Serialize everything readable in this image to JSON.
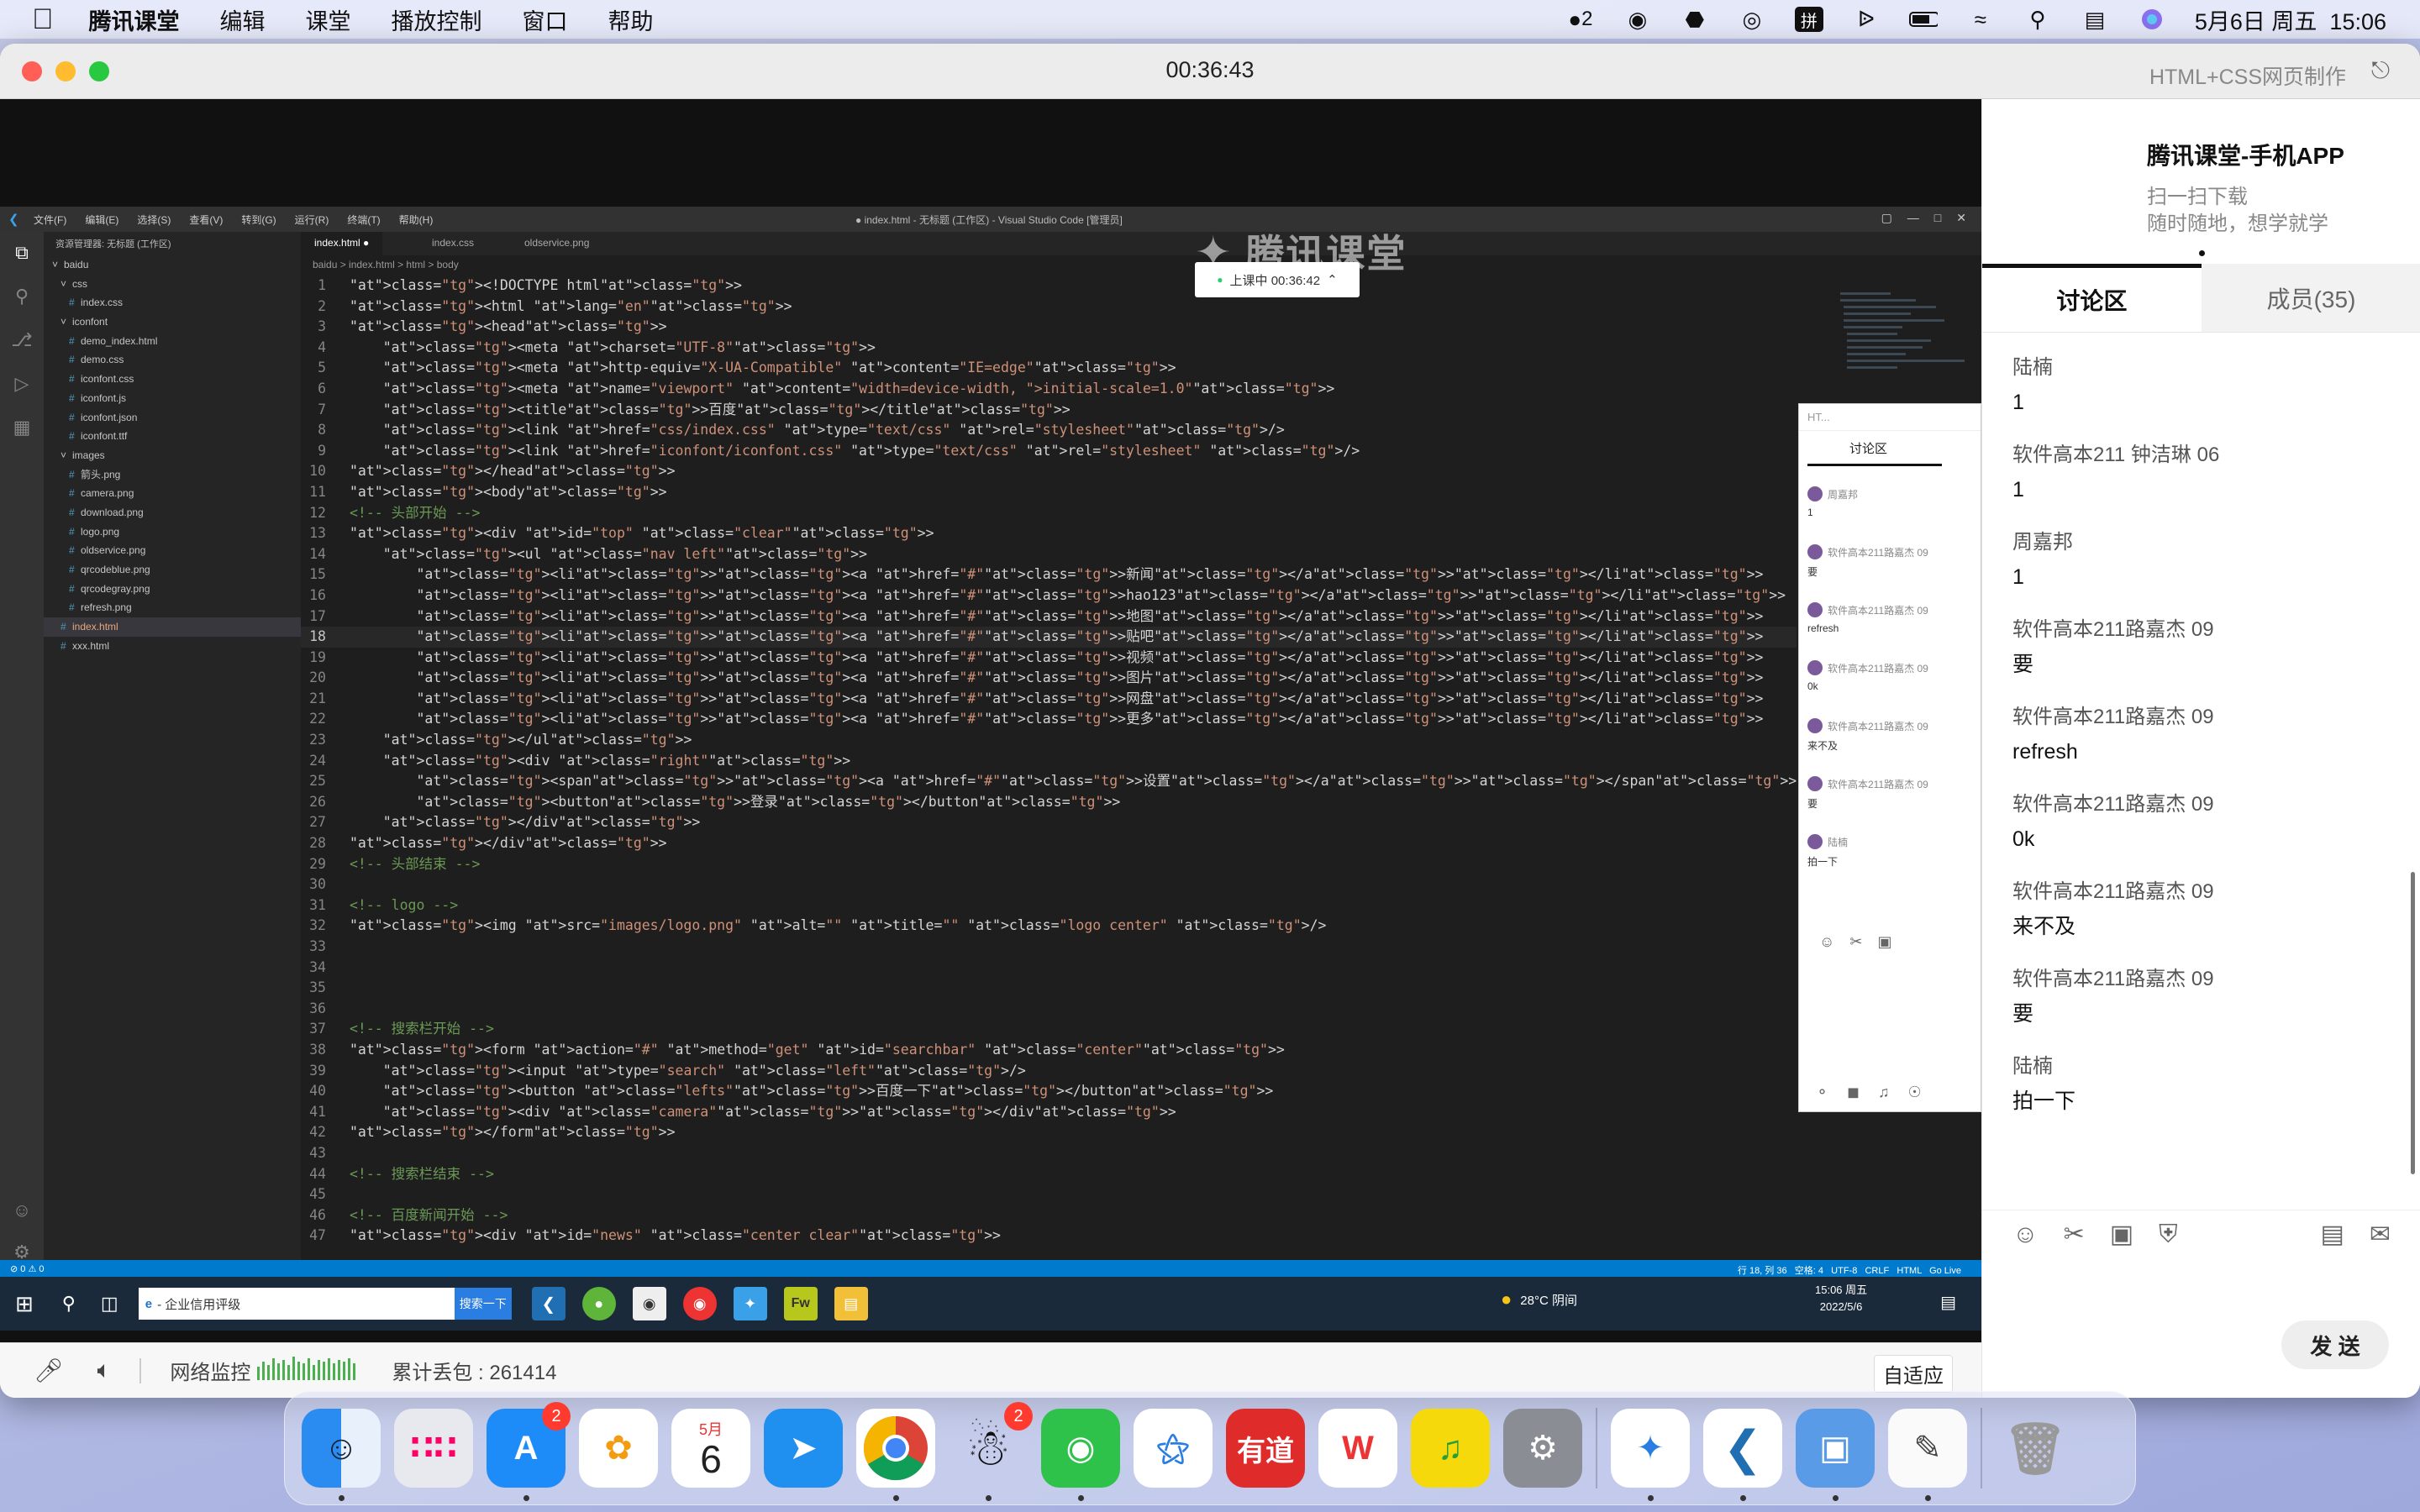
{
  "menubar": {
    "app_name": "腾讯课堂",
    "items": [
      "编辑",
      "课堂",
      "播放控制",
      "窗口",
      "帮助"
    ],
    "qq_badge": "2",
    "ime_label": "拼",
    "datetime": "5月6日 周五  15:06"
  },
  "window": {
    "timer": "00:36:43",
    "course_name": "HTML+CSS网页制作"
  },
  "video": {
    "watermark": "腾讯课堂",
    "live_badge": "上课中 00:36:42",
    "vscode": {
      "title": "● index.html - 无标题 (工作区) - Visual Studio Code [管理员]",
      "menu": [
        "文件(F)",
        "编辑(E)",
        "选择(S)",
        "查看(V)",
        "转到(G)",
        "运行(R)",
        "终端(T)",
        "帮助(H)"
      ],
      "explorer_header": "资源管理器: 无标题 (工作区)",
      "tree": [
        "baidu",
        "css",
        "index.css",
        "iconfont",
        "demo_index.html",
        "demo.css",
        "iconfont.css",
        "iconfont.js",
        "iconfont.json",
        "iconfont.ttf",
        "images",
        "箭头.png",
        "camera.png",
        "download.png",
        "logo.png",
        "oldservice.png",
        "qrcodeblue.png",
        "qrcodegray.png",
        "refresh.png",
        "index.html",
        "xxx.html"
      ],
      "tabs": [
        "index.html ●",
        "index.css",
        "oldservice.png"
      ],
      "breadcrumb": "baidu > index.html > html > body",
      "status_right": "行 18, 列 36   空格: 4   UTF-8   CRLF   HTML   Go Live",
      "code_lines": [
        "<!DOCTYPE html>",
        "<html lang=\"en\">",
        "<head>",
        "    <meta charset=\"UTF-8\">",
        "    <meta http-equiv=\"X-UA-Compatible\" content=\"IE=edge\">",
        "    <meta name=\"viewport\" content=\"width=device-width, initial-scale=1.0\">",
        "    <title>百度</title>",
        "    <link href=\"css/index.css\" type=\"text/css\" rel=\"stylesheet\"/>",
        "    <link href=\"iconfont/iconfont.css\" type=\"text/css\" rel=\"stylesheet\" />",
        "</head>",
        "<body>",
        "<!-- 头部开始 -->",
        "<div id=\"top\" class=\"clear\">",
        "    <ul class=\"nav left\">",
        "        <li><a href=\"#\">新闻</a></li>",
        "        <li><a href=\"#\">hao123</a></li>",
        "        <li><a href=\"#\">地图</a></li>",
        "        <li><a href=\"#\">贴吧</a></li>",
        "        <li><a href=\"#\">视频</a></li>",
        "        <li><a href=\"#\">图片</a></li>",
        "        <li><a href=\"#\">网盘</a></li>",
        "        <li><a href=\"#\">更多</a></li>",
        "    </ul>",
        "    <div class=\"right\">",
        "        <span><a href=\"#\">设置</a></span>",
        "        <button>登录</button>",
        "    </div>",
        "</div>",
        "<!-- 头部结束 -->",
        "",
        "<!-- logo -->",
        "<img src=\"images/logo.png\" alt=\"\" title=\"\" class=\"logo center\" />",
        "",
        "",
        "",
        "",
        "<!-- 搜索栏开始 -->",
        "<form action=\"#\" method=\"get\" id=\"searchbar\" class=\"center\">",
        "    <input type=\"search\" class=\"left\"/>",
        "    <button class=\"lefts\">百度一下</button>",
        "    <div class=\"camera\"></div>",
        "</form>",
        "",
        "<!-- 搜索栏结束 -->",
        "",
        "<!-- 百度新闻开始 -->",
        "<div id=\"news\" class=\"center clear\">"
      ]
    },
    "taskbar": {
      "search_text": "- 企业信用评级",
      "search_button": "搜索一下",
      "weather": "28°C 阴间",
      "clock": "15:06 周五",
      "date": "2022/5/6"
    },
    "subwindow": {
      "title": "HT...",
      "tab": "讨论区",
      "items": [
        {
          "name": "周嘉邦",
          "text": "1"
        },
        {
          "name": "软件高本211路嘉杰 09",
          "text": "要"
        },
        {
          "name": "软件高本211路嘉杰 09",
          "text": "refresh"
        },
        {
          "name": "软件高本211路嘉杰 09",
          "text": "0k"
        },
        {
          "name": "软件高本211路嘉杰 09",
          "text": "来不及"
        },
        {
          "name": "软件高本211路嘉杰 09",
          "text": "要"
        },
        {
          "name": "陆楠",
          "text": "拍一下"
        }
      ]
    }
  },
  "bottombar": {
    "network_label": "网络监控",
    "packet_loss": "累计丢包 : 261414",
    "fit_label": "自适应"
  },
  "panel": {
    "app_title": "腾讯课堂-手机APP",
    "subtitle1": "扫一扫下载",
    "subtitle2": "随时随地，想学就学",
    "tab_discussion": "讨论区",
    "tab_members": "成员(35)",
    "messages": [
      {
        "name": "陆楠",
        "text": "1"
      },
      {
        "name": "软件高本211 钟洁琳 06",
        "text": "1"
      },
      {
        "name": "周嘉邦",
        "text": "1"
      },
      {
        "name": "软件高本211路嘉杰 09",
        "text": "要"
      },
      {
        "name": "软件高本211路嘉杰 09",
        "text": "refresh"
      },
      {
        "name": "软件高本211路嘉杰 09",
        "text": "0k"
      },
      {
        "name": "软件高本211路嘉杰 09",
        "text": "来不及"
      },
      {
        "name": "软件高本211路嘉杰 09",
        "text": "要"
      },
      {
        "name": "陆楠",
        "text": "拍一下"
      }
    ],
    "send_label": "发 送"
  },
  "dock": {
    "calendar_month": "5月",
    "calendar_day": "6",
    "appstore_badge": "2",
    "qq_badge": "2",
    "youdao_label": "有道"
  }
}
